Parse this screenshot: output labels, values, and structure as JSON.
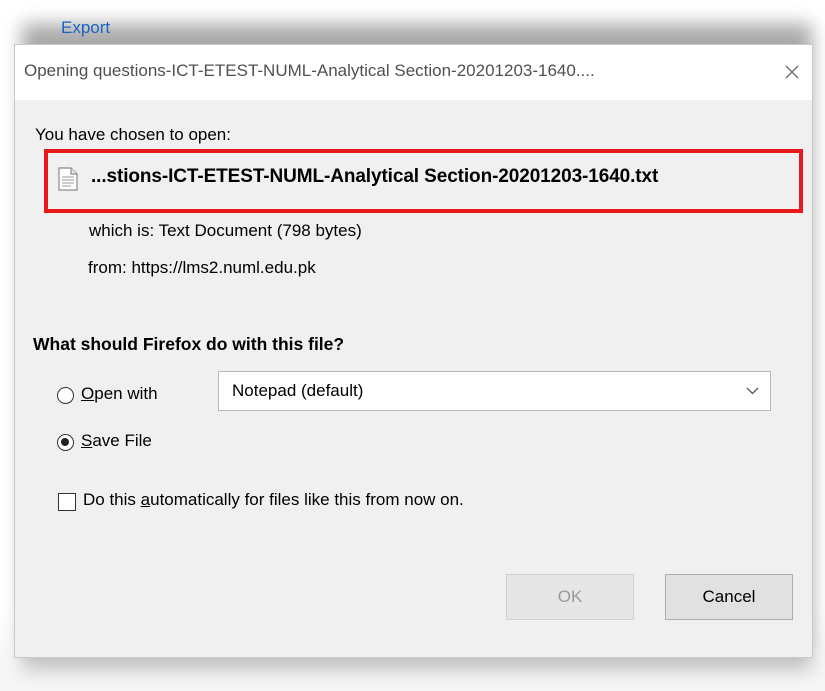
{
  "page": {
    "export_link": "Export"
  },
  "dialog": {
    "title": "Opening questions-ICT-ETEST-NUML-Analytical Section-20201203-1640....",
    "close_icon": "close-icon",
    "chosen_label": "You have chosen to open:",
    "file_icon": "text-file-icon",
    "filename": "...stions-ICT-ETEST-NUML-Analytical Section-20201203-1640.txt",
    "which_is": "which is:  Text Document (798 bytes)",
    "from": "from:  https://lms2.numl.edu.pk",
    "question": "What should Firefox do with this file?",
    "open_with": {
      "label_first": "O",
      "label_rest": "pen with",
      "selected": false
    },
    "open_with_select": {
      "value": "Notepad (default)"
    },
    "save_file": {
      "label_first": "S",
      "label_rest": "ave File",
      "selected": true
    },
    "auto_checkbox": {
      "label_before": "Do this ",
      "label_underlined": "a",
      "label_after": "utomatically for files like this from now on.",
      "checked": false
    },
    "ok_button": "OK",
    "cancel_button": "Cancel"
  },
  "colors": {
    "highlight": "#e8191b",
    "link": "#1a62c4"
  }
}
